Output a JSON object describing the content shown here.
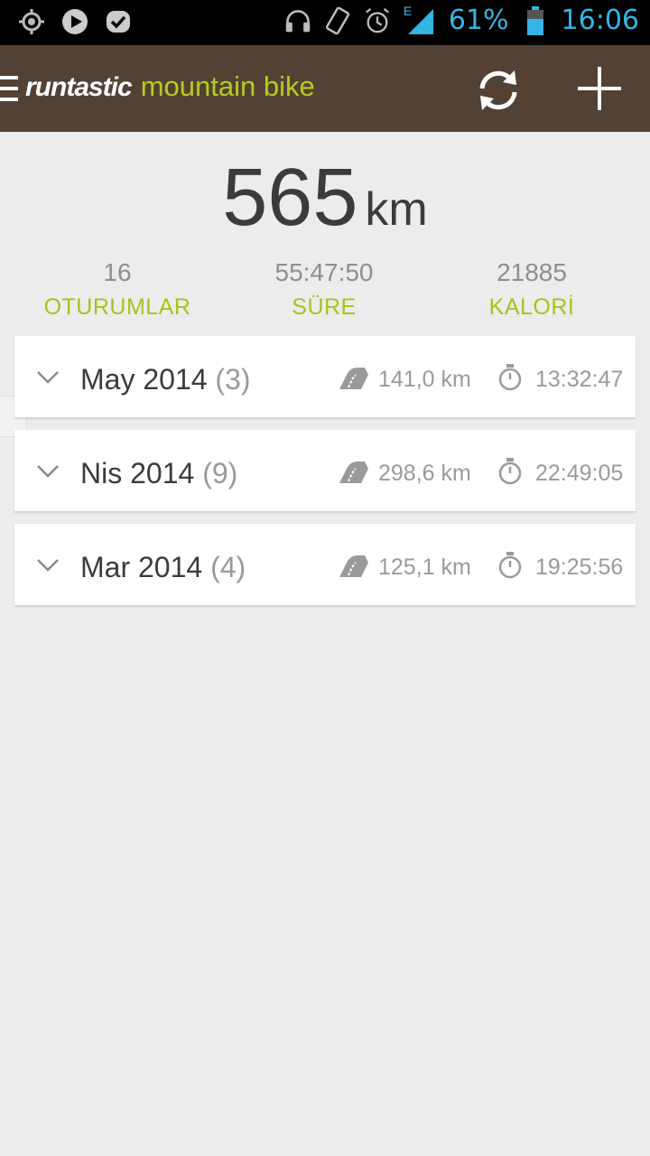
{
  "status_bar": {
    "icons_left": [
      "location-icon",
      "play-icon",
      "check-badge-icon"
    ],
    "icons_right": [
      "headphones-icon",
      "vibrate-icon",
      "alarm-icon",
      "signal-icon"
    ],
    "network_label": "E",
    "battery_percent": "61%",
    "time": "16:06",
    "accent_color": "#33b5e5"
  },
  "app_bar": {
    "brand": "runtastic",
    "app_name": "mountain bike",
    "background_color": "#534234",
    "accent_color": "#b8cc1f",
    "actions": [
      "sync-icon",
      "add-icon"
    ]
  },
  "summary": {
    "distance_value": "565",
    "distance_unit": "km",
    "stats": [
      {
        "value": "16",
        "label": "OTURUMLAR"
      },
      {
        "value": "55:47:50",
        "label": "SÜRE"
      },
      {
        "value": "21885",
        "label": "KALORİ"
      }
    ]
  },
  "months": [
    {
      "month": "May 2014",
      "count": "(3)",
      "distance": "141,0 km",
      "duration": "13:32:47"
    },
    {
      "month": "Nis 2014",
      "count": "(9)",
      "distance": "298,6 km",
      "duration": "22:49:05"
    },
    {
      "month": "Mar 2014",
      "count": "(4)",
      "distance": "125,1 km",
      "duration": "19:25:56"
    }
  ]
}
